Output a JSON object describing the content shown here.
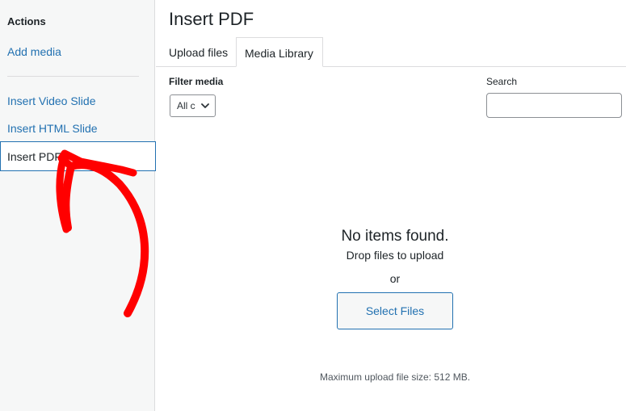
{
  "sidebar": {
    "heading": "Actions",
    "add_media": "Add media",
    "items": [
      {
        "label": "Insert Video Slide"
      },
      {
        "label": "Insert HTML Slide"
      },
      {
        "label": "Insert PDF",
        "active": true
      }
    ]
  },
  "main": {
    "title": "Insert PDF",
    "tabs": [
      {
        "label": "Upload files"
      },
      {
        "label": "Media Library",
        "active": true
      }
    ],
    "filter": {
      "label": "Filter media",
      "selected": "All c"
    },
    "search": {
      "label": "Search",
      "value": "",
      "placeholder": ""
    },
    "empty": {
      "title": "No items found.",
      "drop": "Drop files to upload",
      "or": "or",
      "button": "Select Files",
      "max_size": "Maximum upload file size: 512 MB."
    }
  },
  "colors": {
    "accent": "#2271b1",
    "annotation": "#ff0000"
  },
  "icons": {
    "filter_chevron": "chevron-down-icon",
    "annotation": "red-arrow-annotation"
  }
}
